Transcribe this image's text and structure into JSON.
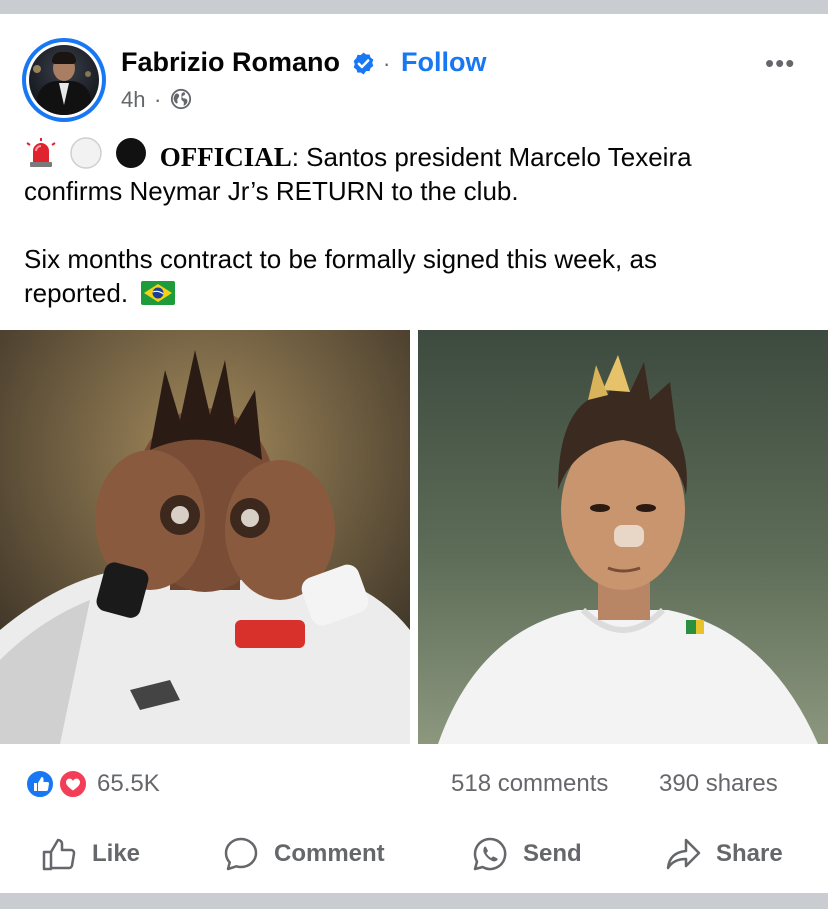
{
  "post": {
    "author": "Fabrizio Romano",
    "follow_label": "Follow",
    "separator": "·",
    "time": "4h",
    "more_label": "•••",
    "text": {
      "line1_bold": "OFFICIAL",
      "line1_rest": ": Santos president Marcelo Texeira",
      "line2": "confirms Neymar Jr’s RETURN to the club.",
      "line3": "Six months contract to be formally signed this week, as",
      "line4": "reported."
    },
    "emojis": [
      "siren-emoji",
      "white-circle-emoji",
      "black-circle-emoji",
      "brazil-flag-emoji"
    ]
  },
  "engagement": {
    "reaction_icons": [
      "like-reaction-icon",
      "love-reaction-icon"
    ],
    "reaction_count": "65.5K",
    "comments": "518 comments",
    "shares": "390 shares"
  },
  "actions": {
    "like": "Like",
    "comment": "Comment",
    "send": "Send",
    "share": "Share"
  },
  "colors": {
    "accent": "#1877f2",
    "secondary_text": "#65676b",
    "love": "#f33e58",
    "divider": "#c9ccd1"
  }
}
